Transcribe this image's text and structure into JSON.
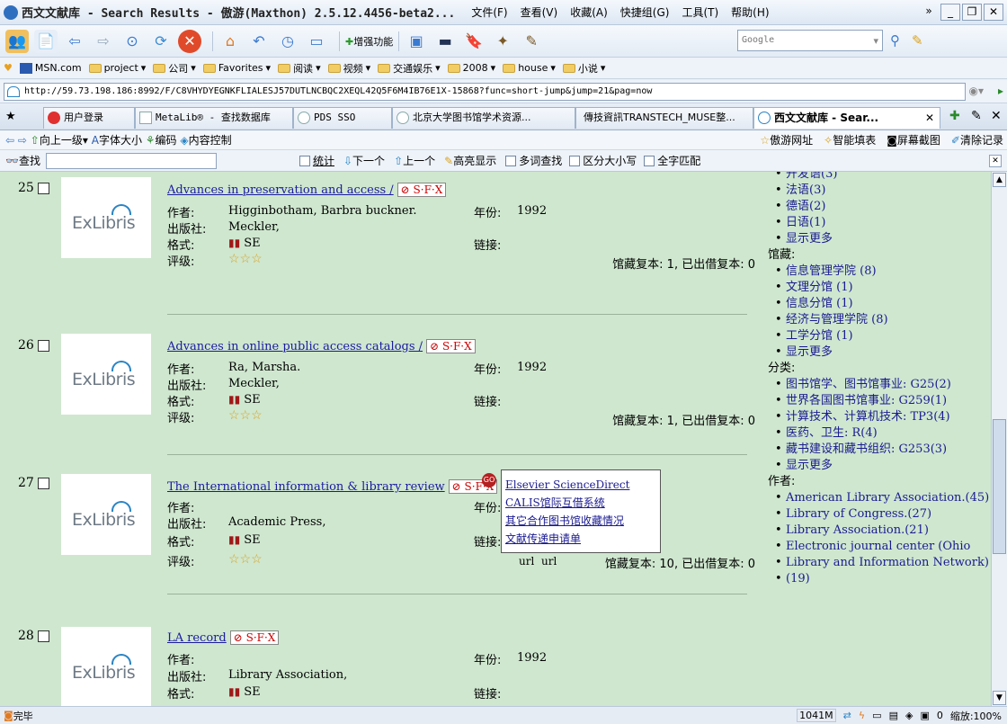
{
  "window": {
    "title": "西文文献库 - Search Results - 傲游(Maxthon) 2.5.12.4456-beta2...",
    "menu": [
      "文件(F)",
      "查看(V)",
      "收藏(A)",
      "快捷组(G)",
      "工具(T)",
      "帮助(H)"
    ]
  },
  "toolbar": {
    "enhance_label": "增强功能",
    "search_engine": "Google"
  },
  "favorites": [
    "MSN.com",
    "project",
    "公司",
    "Favorites",
    "阅读",
    "视频",
    "交通娱乐",
    "2008",
    "house",
    "小说"
  ],
  "address": {
    "url": "http://59.73.198.186:8992/F/C8VHYDYEGNKFLIALESJ57DUTLNCBQC2XEQL42Q5F6M4IB76E1X-15868?func=short-jump&jump=21&pag=now"
  },
  "tabs": [
    "用户登录",
    "MetaLib® - 查找数据库",
    "PDS SSO",
    "北京大学图书馆学术资源...",
    "傳技資訊TRANSTECH_MUSE整...",
    "西文文献库 - Sear..."
  ],
  "nav": {
    "up": "向上一级",
    "font_size": "字体大小",
    "encoding": "编码",
    "content_control": "内容控制",
    "right": [
      "傲游网址",
      "智能填表",
      "屏幕截图",
      "清除记录"
    ]
  },
  "findbar": {
    "label": "查找",
    "stats": "统计",
    "next": "下一个",
    "prev": "上一个",
    "highlight": "高亮显示",
    "multi": "多词查找",
    "case": "区分大小写",
    "whole": "全字匹配"
  },
  "labels": {
    "author": "作者:",
    "publisher": "出版社:",
    "format": "格式:",
    "rating": "评级:",
    "year": "年份:",
    "link": "链接:",
    "logo": "ExLibris",
    "sfx": "S·F·X"
  },
  "records": [
    {
      "num": "25",
      "title": "Advances in preservation and access /",
      "author": "Higginbotham, Barbra buckner.",
      "publisher": "Meckler,",
      "format": "SE",
      "rating": "☆☆☆",
      "year": "1992",
      "holdings": "馆藏复本: 1, 已出借复本: 0"
    },
    {
      "num": "26",
      "title": "Advances in online public access catalogs /",
      "author": "Ra, Marsha.",
      "publisher": "Meckler,",
      "format": "SE",
      "rating": "☆☆☆",
      "year": "1992",
      "holdings": "馆藏复本: 1, 已出借复本: 0"
    },
    {
      "num": "27",
      "title": "The International information & library review",
      "author": "",
      "publisher": "Academic Press,",
      "format": "SE",
      "rating": "☆☆☆",
      "year": "",
      "holdings": "馆藏复本: 10, 已出借复本: 0",
      "url_links": [
        "url",
        "url"
      ]
    },
    {
      "num": "28",
      "title": "LA record",
      "author": "",
      "publisher": "Library Association,",
      "format": "SE",
      "rating": "",
      "year": "1992",
      "holdings": ""
    }
  ],
  "go_badge": "GO",
  "popup": [
    "Elsevier ScienceDirect",
    "CALIS馆际互借系统",
    "其它合作图书馆收藏情况",
    "文献传递申请单"
  ],
  "facets": {
    "lang_cut": "开发语(3)",
    "languages": [
      "法语(3)",
      "德语(2)",
      "日语(1)"
    ],
    "more": "显示更多",
    "holdings_head": "馆藏:",
    "holdings": [
      "信息管理学院 (8)",
      "文理分馆 (1)",
      "信息分馆 (1)",
      "经济与管理学院 (8)",
      "工学分馆 (1)"
    ],
    "class_head": "分类:",
    "classes": [
      "图书馆学、图书馆事业: G25(2)",
      "世界各国图书馆事业: G259(1)",
      "计算技术、计算机技术: TP3(4)",
      "医药、卫生: R(4)",
      "藏书建设和藏书组织: G253(3)"
    ],
    "author_head": "作者:",
    "authors": [
      "American Library Association.(45)",
      "Library of Congress.(27)",
      "Library Association.(21)",
      "Electronic journal center (Ohio",
      "Library and Information Network)",
      "(19)"
    ]
  },
  "status": {
    "left": "完毕",
    "memory": "1041M",
    "zoom": "缩放:100%",
    "count": "0"
  }
}
